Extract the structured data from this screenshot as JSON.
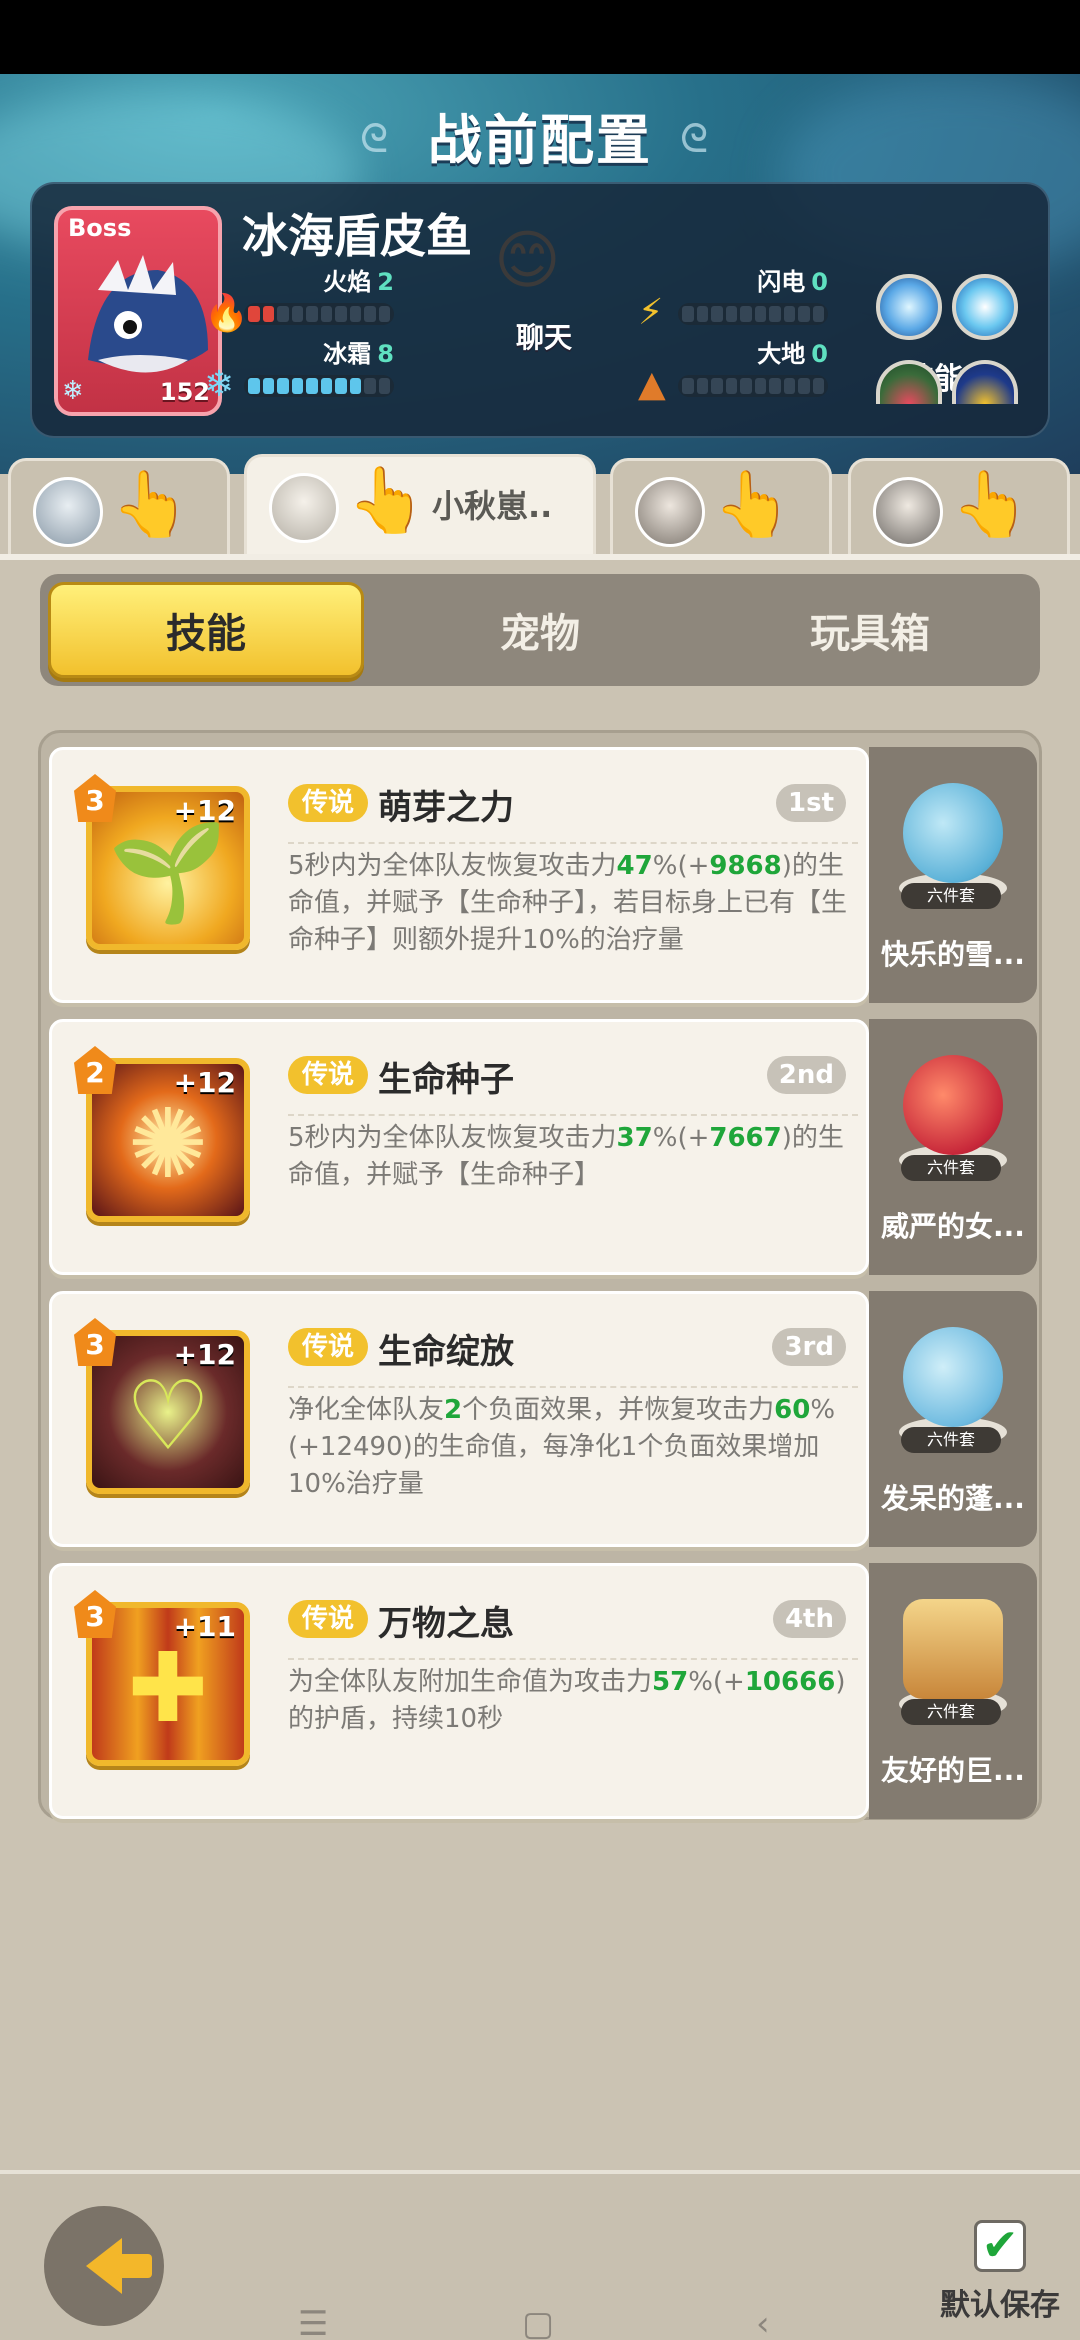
{
  "title": "战前配置",
  "boss": {
    "tag": "Boss",
    "name": "冰海盾皮鱼",
    "level": "152",
    "chat_label": "聊天",
    "skills_label": "技能",
    "elements": [
      {
        "label": "火焰",
        "value": "2",
        "filled": 2,
        "total": 10,
        "color": "#e0463b"
      },
      {
        "label": "闪电",
        "value": "0",
        "filled": 0,
        "total": 10,
        "color": "#f2c12d"
      },
      {
        "label": "冰霜",
        "value": "8",
        "filled": 8,
        "total": 10,
        "color": "#5ec6ec"
      },
      {
        "label": "大地",
        "value": "0",
        "filled": 0,
        "total": 10,
        "color": "#e07b2a"
      }
    ]
  },
  "players": [
    {
      "name": ""
    },
    {
      "name": "小秋崽.."
    },
    {
      "name": ""
    },
    {
      "name": ""
    }
  ],
  "tabs": [
    "技能",
    "宠物",
    "玩具箱"
  ],
  "skills": [
    {
      "level": "3",
      "plus": "+12",
      "rarity": "传说",
      "name": "萌芽之力",
      "rank": "1st",
      "desc_before": "5秒内为全体队友恢复攻击力",
      "hl1": "47",
      "mid1": "%(+",
      "hl2": "9868",
      "desc_after": ")的生命值，并赋予【生命种子】，若目标身上已有【生命种子】则额外提升10%的治疗量",
      "pet": {
        "set": "六件套",
        "name": "快乐的雪..."
      }
    },
    {
      "level": "2",
      "plus": "+12",
      "rarity": "传说",
      "name": "生命种子",
      "rank": "2nd",
      "desc_before": "5秒内为全体队友恢复攻击力",
      "hl1": "37",
      "mid1": "%(+",
      "hl2": "7667",
      "desc_after": ")的生命值，并赋予【生命种子】",
      "pet": {
        "set": "六件套",
        "name": "威严的女..."
      }
    },
    {
      "level": "3",
      "plus": "+12",
      "rarity": "传说",
      "name": "生命绽放",
      "rank": "3rd",
      "desc_before": "净化全体队友",
      "hl1": "2",
      "mid1": "个负面效果，并恢复攻击力",
      "hl2": "60",
      "desc_after": "%(+12490)的生命值，每净化1个负面效果增加10%治疗量",
      "pet": {
        "set": "六件套",
        "name": "发呆的蓬..."
      }
    },
    {
      "level": "3",
      "plus": "+11",
      "rarity": "传说",
      "name": "万物之息",
      "rank": "4th",
      "desc_before": "为全体队友附加生命值为攻击力",
      "hl1": "57",
      "mid1": "%(+",
      "hl2": "10666",
      "desc_after": ")的护盾，持续10秒",
      "pet": {
        "set": "六件套",
        "name": "友好的巨..."
      }
    }
  ],
  "footer": {
    "save_label": "默认保存",
    "save_checked": true
  }
}
